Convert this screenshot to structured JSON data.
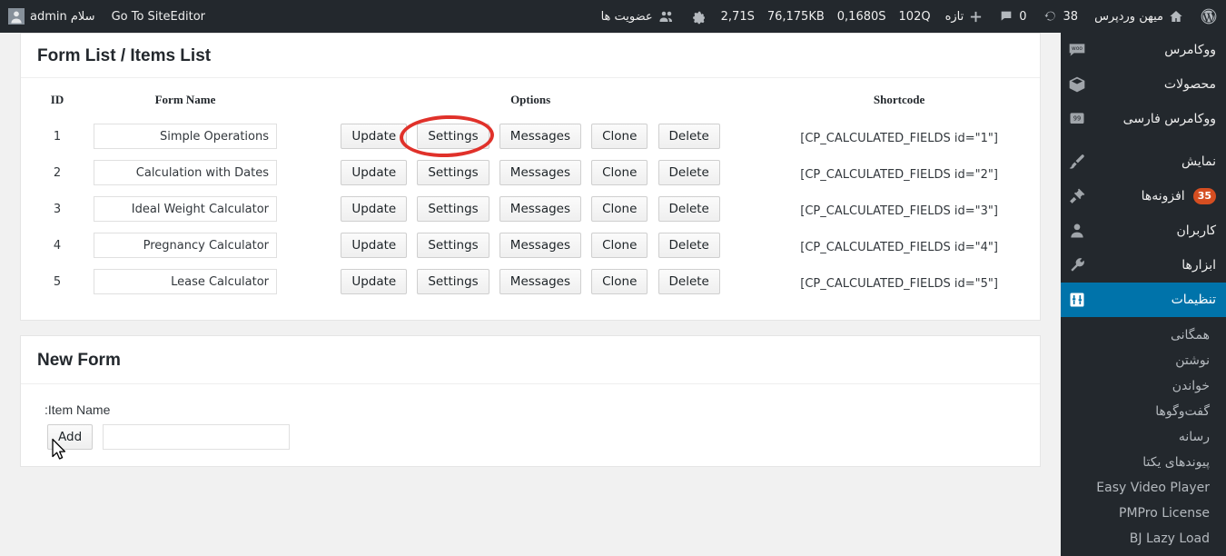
{
  "adminbar": {
    "wp_logo_icon": "wordpress-logo-icon",
    "site_name": "میهن وردپرس",
    "home_icon": "home-icon",
    "updates_count": "38",
    "updates_icon": "refresh-icon",
    "comments_count": "0",
    "comments_icon": "comment-icon",
    "new_label": "تازه",
    "new_icon": "plus-icon",
    "queries": "102Q",
    "time_2": "0,1680S",
    "memory": "76,175KB",
    "time_1": "2,71S",
    "gear_icon": "gear-icon",
    "members_label": "عضویت ها",
    "members_icon": "group-icon",
    "greeting": "سلام admin",
    "avatar_icon": "avatar-icon",
    "site_editor_label": "Go To SiteEditor"
  },
  "sidebar": {
    "items": [
      {
        "label": "ووکامرس",
        "icon": "woo-icon",
        "badge": ""
      },
      {
        "label": "محصولات",
        "icon": "box-icon",
        "badge": ""
      },
      {
        "label": "ووکامرس فارسی",
        "icon": "quote-icon",
        "badge": ""
      },
      {
        "label": "نمایش",
        "icon": "brush-icon",
        "badge": ""
      },
      {
        "label": "افزونه‌ها",
        "icon": "plug-icon",
        "badge": "35"
      },
      {
        "label": "کاربران",
        "icon": "user-icon",
        "badge": ""
      },
      {
        "label": "ابزارها",
        "icon": "wrench-icon",
        "badge": ""
      },
      {
        "label": "تنظیمات",
        "icon": "sliders-icon",
        "badge": ""
      }
    ],
    "active_index": 7,
    "submenu": [
      {
        "label": "همگانی",
        "ltr": false
      },
      {
        "label": "نوشتن",
        "ltr": false
      },
      {
        "label": "خواندن",
        "ltr": false
      },
      {
        "label": "گفت‌وگوها",
        "ltr": false
      },
      {
        "label": "رسانه",
        "ltr": false
      },
      {
        "label": "پیوندهای یکتا",
        "ltr": false
      },
      {
        "label": "Easy Video Player",
        "ltr": true
      },
      {
        "label": "PMPro License",
        "ltr": true
      },
      {
        "label": "BJ Lazy Load",
        "ltr": true
      }
    ]
  },
  "form_list": {
    "title": "Form List / Items List",
    "columns": {
      "shortcode": "Shortcode",
      "options": "Options",
      "form_name": "Form Name",
      "id": "ID"
    },
    "buttons": {
      "delete": "Delete",
      "clone": "Clone",
      "messages": "Messages",
      "settings": "Settings",
      "update": "Update"
    },
    "highlight": {
      "target": "settings-button-row-1",
      "color": "#e0312a",
      "shape": "ellipse"
    },
    "rows": [
      {
        "shortcode": "[\"CP_CALCULATED_FIELDS id=\"1]",
        "name": "Simple Operations",
        "id": "1"
      },
      {
        "shortcode": "[\"CP_CALCULATED_FIELDS id=\"2]",
        "name": "Calculation with Dates",
        "id": "2"
      },
      {
        "shortcode": "[\"CP_CALCULATED_FIELDS id=\"3]",
        "name": "Ideal Weight Calculator",
        "id": "3"
      },
      {
        "shortcode": "[\"CP_CALCULATED_FIELDS id=\"4]",
        "name": "Pregnancy Calculator",
        "id": "4"
      },
      {
        "shortcode": "[\"CP_CALCULATED_FIELDS id=\"5]",
        "name": "Lease Calculator",
        "id": "5"
      }
    ]
  },
  "new_form": {
    "title": "New Form",
    "item_name_label": ":Item Name",
    "item_name_value": "",
    "item_name_placeholder": "",
    "add_label": "Add"
  }
}
